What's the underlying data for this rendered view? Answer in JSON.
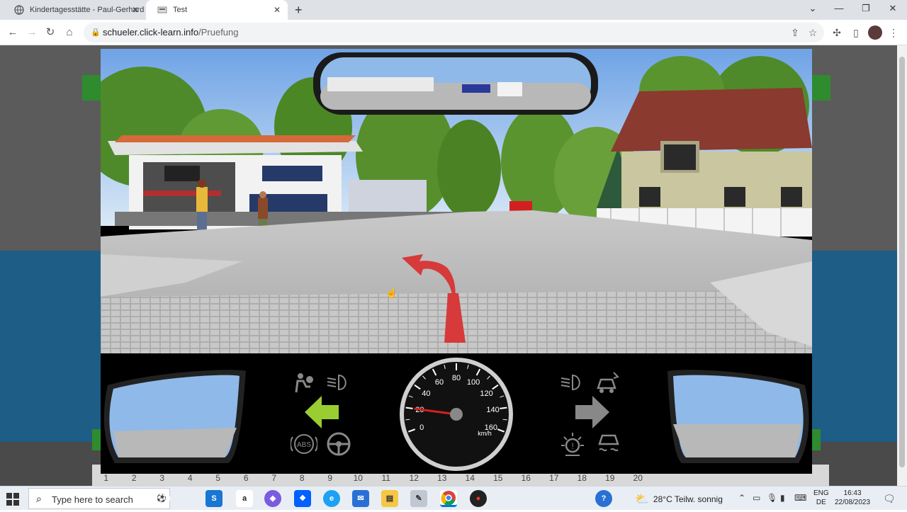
{
  "browser": {
    "tabs": [
      {
        "title": "Kindertagesstätte - Paul-Gerhard",
        "active": false
      },
      {
        "title": "Test",
        "active": true
      }
    ],
    "url": {
      "host": "schueler.click-learn.info",
      "path": "/Pruefung"
    }
  },
  "exam": {
    "page_numbers": [
      "1",
      "2",
      "3",
      "4",
      "5",
      "6",
      "7",
      "8",
      "9",
      "10",
      "11",
      "12",
      "13",
      "14",
      "15",
      "16",
      "17",
      "18",
      "19",
      "20"
    ],
    "speedometer": {
      "ticks": [
        "0",
        "20",
        "40",
        "60",
        "80",
        "100",
        "120",
        "140",
        "160"
      ],
      "unit": "km/h",
      "speed_kmh": 20
    },
    "indicators": {
      "left_turn_signal": "on",
      "right_turn_signal": "off",
      "abs_label": "ABS"
    },
    "colors": {
      "left_signal": "#9acd32",
      "right_signal": "#888888",
      "turn_arrow": "#d63a3a"
    }
  },
  "taskbar": {
    "search_placeholder": "Type here to search",
    "weather": "28°C  Teilw. sonnig",
    "language": {
      "line1": "ENG",
      "line2": "DE"
    },
    "clock": {
      "time": "16:43",
      "date": "22/08/2023"
    }
  }
}
